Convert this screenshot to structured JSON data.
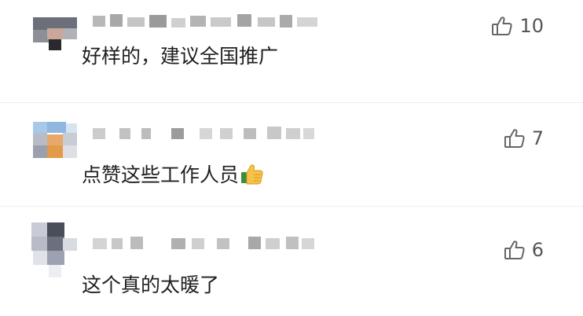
{
  "comments": [
    {
      "text": "好样的，建议全国推广",
      "likes": "10",
      "emoji": ""
    },
    {
      "text": "点赞这些工作人员",
      "likes": "7",
      "emoji": "thumbs-up-emoji"
    },
    {
      "text": "这个真的太暖了",
      "likes": "6",
      "emoji": ""
    }
  ],
  "icons": {
    "like": "thumbs-up-outline-icon"
  },
  "colors": {
    "text": "#1f1f1f",
    "like_count": "#555555",
    "divider": "#eeeeee"
  }
}
